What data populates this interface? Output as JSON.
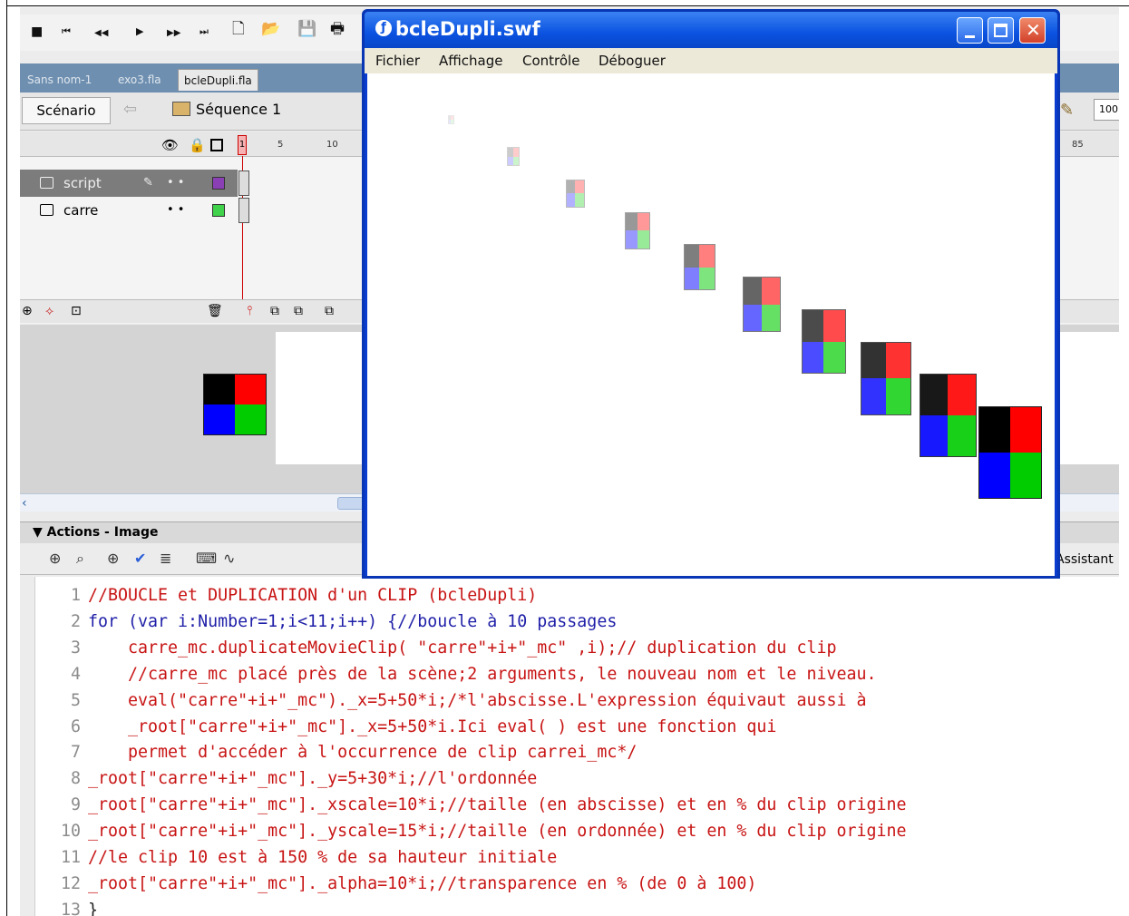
{
  "ide": {
    "toolbar_glyphs": [
      "■",
      "⏮",
      "◀◀",
      "▶",
      "▶▶",
      "⏭",
      "🗋",
      "📂",
      "💾",
      "🖶"
    ],
    "doc_tabs": [
      "Sans nom-1",
      "exo3.fla",
      "bcleDupli.fla"
    ],
    "scenario_label": "Scénario",
    "sequence_label": "Séquence 1",
    "zoom_value": "100",
    "ruler": [
      "1",
      "5",
      "10",
      "85"
    ],
    "layers": [
      {
        "name": "script",
        "dots": "• •",
        "color": "#8b3fb5"
      },
      {
        "name": "carre",
        "dots": "• •",
        "color": "#3fd24a"
      }
    ],
    "actions_title": "Actions - Image",
    "assistant_label": "Assistant"
  },
  "swf": {
    "title": "bcleDupli.swf",
    "menus": [
      "Fichier",
      "Affichage",
      "Contrôle",
      "Déboguer"
    ],
    "clips_count": 10
  },
  "code": {
    "lines": [
      {
        "n": "1",
        "text": "//BOUCLE et DUPLICATION d'un CLIP (bcleDupli)",
        "kind": "comment"
      },
      {
        "n": "2",
        "text": "for (var i:Number=1;i<11;i++) {//boucle à 10 passages",
        "kind": "kw"
      },
      {
        "n": "3",
        "text": "    carre_mc.duplicateMovieClip( \"carre\"+i+\"_mc\" ,i);// duplication du clip",
        "kind": "comment"
      },
      {
        "n": "4",
        "text": "    //carre_mc placé près de la scène;2 arguments, le nouveau nom et le niveau.",
        "kind": "comment"
      },
      {
        "n": "5",
        "text": "    eval(\"carre\"+i+\"_mc\")._x=5+50*i;/*l'abscisse.L'expression équivaut aussi à",
        "kind": "comment"
      },
      {
        "n": "6",
        "text": "    _root[\"carre\"+i+\"_mc\"]._x=5+50*i.Ici eval( ) est une fonction qui",
        "kind": "comment"
      },
      {
        "n": "7",
        "text": "    permet d'accéder à l'occurrence de clip carrei_mc*/",
        "kind": "comment"
      },
      {
        "n": "8",
        "text": "_root[\"carre\"+i+\"_mc\"]._y=5+30*i;//l'ordonnée",
        "kind": "comment"
      },
      {
        "n": "9",
        "text": "_root[\"carre\"+i+\"_mc\"]._xscale=10*i;//taille (en abscisse) et en % du clip origine",
        "kind": "comment"
      },
      {
        "n": "10",
        "text": "_root[\"carre\"+i+\"_mc\"]._yscale=15*i;//taille (en ordonnée) et en % du clip origine",
        "kind": "comment"
      },
      {
        "n": "11",
        "text": "//le clip 10 est à 150 % de sa hauteur initiale",
        "kind": "comment"
      },
      {
        "n": "12",
        "text": "_root[\"carre\"+i+\"_mc\"]._alpha=10*i;//transparence en % (de 0 à 100)",
        "kind": "comment"
      },
      {
        "n": "13",
        "text": "}",
        "kind": "plain"
      }
    ]
  },
  "colors": {
    "clip_black": "#000000",
    "clip_red": "#ff0000",
    "clip_blue": "#0000ff",
    "clip_green": "#00cc00",
    "xp_title_blue": "#0a52e0",
    "code_comment_red": "#c81414",
    "code_keyword_blue": "#1f1fa8"
  }
}
